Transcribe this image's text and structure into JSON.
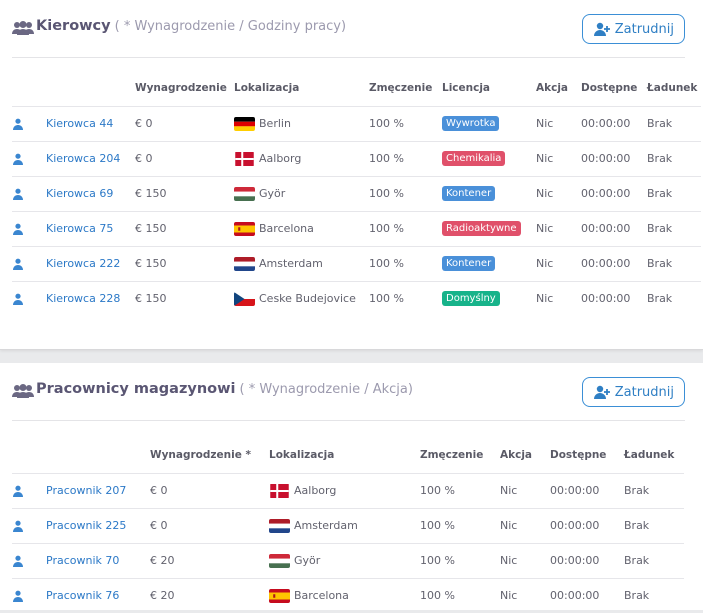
{
  "drivers": {
    "title": "Kierowcy",
    "subtitle": "( * Wynagrodzenie / Godziny pracy)",
    "hire_label": "Zatrudnij",
    "columns": [
      "Wynagrodzenie",
      "Lokalizacja",
      "Zmęczenie",
      "Licencja",
      "Akcja",
      "Dostępne",
      "Ładunek"
    ],
    "rows": [
      {
        "name": "Kierowca 44",
        "salary": "€ 0",
        "city": "Berlin",
        "flag": "de",
        "fatigue": "100 %",
        "license": "Wywrotka",
        "license_color": "blue",
        "action": "Nic",
        "available": "00:00:00",
        "cargo": "Brak"
      },
      {
        "name": "Kierowca 204",
        "salary": "€ 0",
        "city": "Aalborg",
        "flag": "dk",
        "fatigue": "100 %",
        "license": "Chemikalia",
        "license_color": "red",
        "action": "Nic",
        "available": "00:00:00",
        "cargo": "Brak"
      },
      {
        "name": "Kierowca 69",
        "salary": "€ 150",
        "city": "Györ",
        "flag": "hu",
        "fatigue": "100 %",
        "license": "Kontener",
        "license_color": "blue",
        "action": "Nic",
        "available": "00:00:00",
        "cargo": "Brak"
      },
      {
        "name": "Kierowca 75",
        "salary": "€ 150",
        "city": "Barcelona",
        "flag": "es",
        "fatigue": "100 %",
        "license": "Radioaktywne",
        "license_color": "red",
        "action": "Nic",
        "available": "00:00:00",
        "cargo": "Brak"
      },
      {
        "name": "Kierowca 222",
        "salary": "€ 150",
        "city": "Amsterdam",
        "flag": "nl",
        "fatigue": "100 %",
        "license": "Kontener",
        "license_color": "blue",
        "action": "Nic",
        "available": "00:00:00",
        "cargo": "Brak"
      },
      {
        "name": "Kierowca 228",
        "salary": "€ 150",
        "city": "Ceske Budejovice",
        "flag": "cz",
        "fatigue": "100 %",
        "license": "Domyślny",
        "license_color": "green",
        "action": "Nic",
        "available": "00:00:00",
        "cargo": "Brak"
      }
    ]
  },
  "warehouse": {
    "title": "Pracownicy magazynowi",
    "subtitle": "( * Wynagrodzenie / Akcja)",
    "hire_label": "Zatrudnij",
    "columns": [
      "Wynagrodzenie *",
      "Lokalizacja",
      "Zmęczenie",
      "Akcja",
      "Dostępne",
      "Ładunek"
    ],
    "rows": [
      {
        "name": "Pracownik 207",
        "salary": "€ 0",
        "city": "Aalborg",
        "flag": "dk",
        "fatigue": "100 %",
        "action": "Nic",
        "available": "00:00:00",
        "cargo": "Brak"
      },
      {
        "name": "Pracownik 225",
        "salary": "€ 0",
        "city": "Amsterdam",
        "flag": "nl",
        "fatigue": "100 %",
        "action": "Nic",
        "available": "00:00:00",
        "cargo": "Brak"
      },
      {
        "name": "Pracownik 70",
        "salary": "€ 20",
        "city": "Györ",
        "flag": "hu",
        "fatigue": "100 %",
        "action": "Nic",
        "available": "00:00:00",
        "cargo": "Brak"
      },
      {
        "name": "Pracownik 76",
        "salary": "€ 20",
        "city": "Barcelona",
        "flag": "es",
        "fatigue": "100 %",
        "action": "Nic",
        "available": "00:00:00",
        "cargo": "Brak"
      }
    ]
  },
  "colors": {
    "accent": "#2c79c7",
    "title": "#5a5673",
    "badge_blue": "#4a90d9",
    "badge_red": "#e0506a",
    "badge_green": "#17b38a"
  }
}
